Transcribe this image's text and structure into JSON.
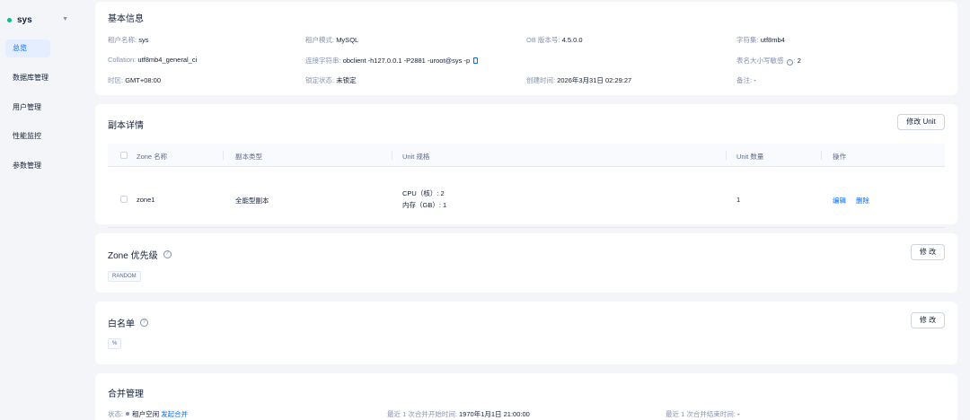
{
  "sidebar": {
    "tenant": "sys",
    "items": [
      {
        "label": "总览",
        "active": true
      },
      {
        "label": "数据库管理"
      },
      {
        "label": "用户管理"
      },
      {
        "label": "性能监控"
      },
      {
        "label": "参数管理"
      }
    ]
  },
  "basic": {
    "title": "基本信息",
    "tenant_name_label": "租户名称:",
    "tenant_name": "sys",
    "tenant_mode_label": "租户模式:",
    "tenant_mode": "MySQL",
    "ob_version_label": "OB 版本号:",
    "ob_version": "4.5.0.0",
    "charset_label": "字符集:",
    "charset": "utf8mb4",
    "collation_label": "Collation:",
    "collation": "utf8mb4_general_ci",
    "conn_label": "连接字符串:",
    "conn": "obclient -h127.0.0.1 -P2881 -uroot@sys -p",
    "case_label": "表名大小写敏感",
    "case_value": "2",
    "timezone_label": "时区:",
    "timezone": "GMT+08:00",
    "lock_label": "锁定状态:",
    "lock": "未锁定",
    "created_label": "创建时间:",
    "created": "2026年3月31日 02:29:27",
    "remark_label": "备注:",
    "remark": "-"
  },
  "replica": {
    "title": "副本详情",
    "edit_button": "修改 Unit",
    "headers": [
      "Zone 名称",
      "副本类型",
      "Unit 规格",
      "Unit 数量",
      "操作"
    ],
    "rows": [
      {
        "zone": "zone1",
        "type": "全能型副本",
        "cpu": "CPU（核）: 2",
        "mem": "内存（GB）: 1",
        "count": "1",
        "edit": "编辑",
        "delete": "删除"
      }
    ]
  },
  "zone_priority": {
    "title": "Zone 优先级",
    "edit_button": "修 改",
    "tag": "RANDOM"
  },
  "whitelist": {
    "title": "白名单",
    "edit_button": "修 改",
    "tag": "%"
  },
  "merge": {
    "title": "合并管理",
    "status_label": "状态:",
    "status": "租户空闲",
    "start_link": "发起合并",
    "last_start_label": "最近 1 次合并开始时间:",
    "last_start": "1970年1月1日 21:00:00",
    "last_end_label": "最近 1 次合并结束时间:",
    "last_end": "-"
  }
}
